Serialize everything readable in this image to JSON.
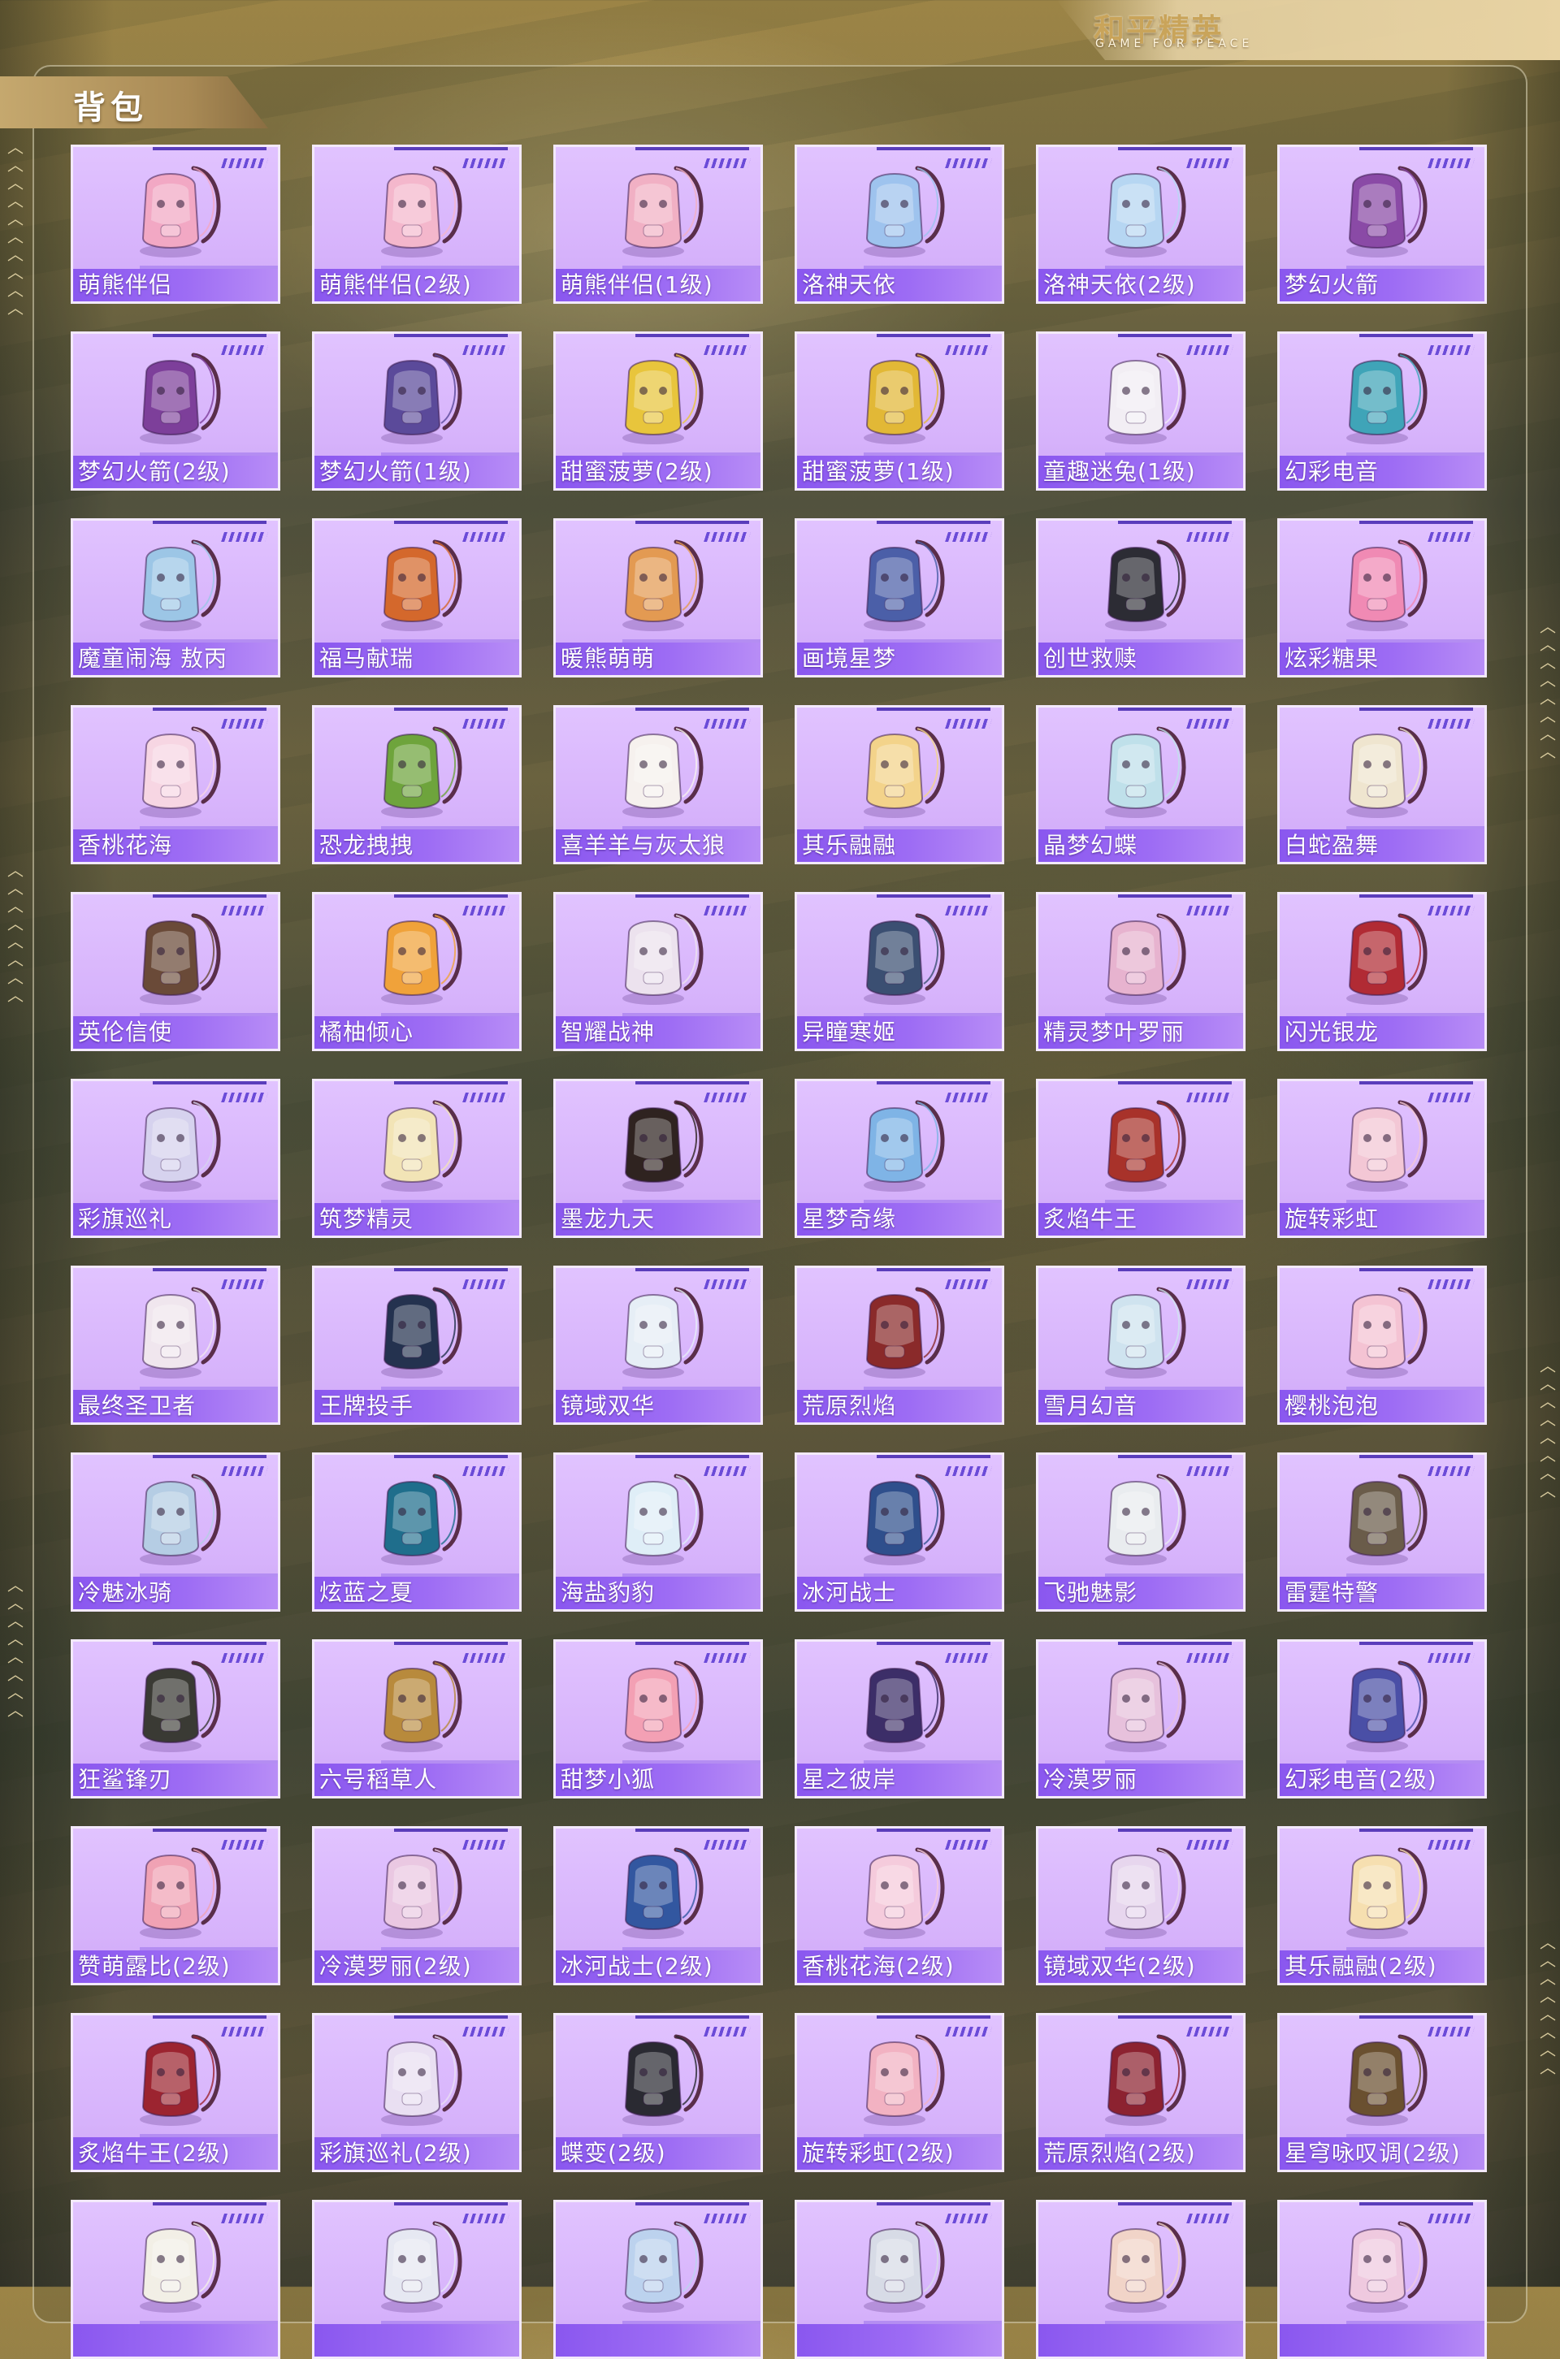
{
  "brand": {
    "title": "和平精英",
    "subtitle": "GAME FOR PEACE"
  },
  "section": {
    "title": "背包"
  },
  "items": [
    {
      "name": "萌熊伴侣",
      "icon": "bear-backpack-icon",
      "color": "#f2a8c4"
    },
    {
      "name": "萌熊伴侣(2级)",
      "icon": "bear-backpack-icon",
      "color": "#f4b7cc"
    },
    {
      "name": "萌熊伴侣(1级)",
      "icon": "bear-backpack-icon",
      "color": "#f1b0c4"
    },
    {
      "name": "洛神天依",
      "icon": "winged-backpack-icon",
      "color": "#9ec3ee"
    },
    {
      "name": "洛神天依(2级)",
      "icon": "winged-backpack-icon",
      "color": "#b6d6f2"
    },
    {
      "name": "梦幻火箭",
      "icon": "rocket-backpack-icon",
      "color": "#8a4aa6"
    },
    {
      "name": "梦幻火箭(2级)",
      "icon": "rocket-backpack-icon",
      "color": "#7d3f9a"
    },
    {
      "name": "梦幻火箭(1级)",
      "icon": "rocket-backpack-icon",
      "color": "#5b4a9a"
    },
    {
      "name": "甜蜜菠萝(2级)",
      "icon": "pineapple-backpack-icon",
      "color": "#e8c53c"
    },
    {
      "name": "甜蜜菠萝(1级)",
      "icon": "pineapple-backpack-icon",
      "color": "#e2b836"
    },
    {
      "name": "童趣迷兔(1级)",
      "icon": "rabbit-backpack-icon",
      "color": "#f2eef4"
    },
    {
      "name": "幻彩电音",
      "icon": "speaker-backpack-icon",
      "color": "#3fa4b8"
    },
    {
      "name": "魔童闹海 敖丙",
      "icon": "swirl-backpack-icon",
      "color": "#9cc6e6"
    },
    {
      "name": "福马献瑞",
      "icon": "horse-backpack-icon",
      "color": "#d4682c"
    },
    {
      "name": "暖熊萌萌",
      "icon": "bear-backpack-icon",
      "color": "#e39a52"
    },
    {
      "name": "画境星梦",
      "icon": "frame-backpack-icon",
      "color": "#4b5fa8"
    },
    {
      "name": "创世救赎",
      "icon": "armor-backpack-icon",
      "color": "#2c2c34"
    },
    {
      "name": "炫彩糖果",
      "icon": "candy-backpack-icon",
      "color": "#f08ab4"
    },
    {
      "name": "香桃花海",
      "icon": "flower-backpack-icon",
      "color": "#f7d6e3"
    },
    {
      "name": "恐龙拽拽",
      "icon": "dino-backpack-icon",
      "color": "#6ea43c"
    },
    {
      "name": "喜羊羊与灰太狼",
      "icon": "sheep-backpack-icon",
      "color": "#f6f1ee"
    },
    {
      "name": "其乐融融",
      "icon": "bunny-backpack-icon",
      "color": "#f3d38a"
    },
    {
      "name": "晶梦幻蝶",
      "icon": "butterfly-backpack-icon",
      "color": "#bfe0ea"
    },
    {
      "name": "白蛇盈舞",
      "icon": "dress-backpack-icon",
      "color": "#efe5cf"
    },
    {
      "name": "英伦信使",
      "icon": "clock-backpack-icon",
      "color": "#6a4a38"
    },
    {
      "name": "橘柚倾心",
      "icon": "orange-backpack-icon",
      "color": "#f0a23a"
    },
    {
      "name": "智耀战神",
      "icon": "warrior-backpack-icon",
      "color": "#ece2ee"
    },
    {
      "name": "异瞳寒姬",
      "icon": "cat-backpack-icon",
      "color": "#3b4f72"
    },
    {
      "name": "精灵梦叶罗丽",
      "icon": "heart-backpack-icon",
      "color": "#e7b3cf"
    },
    {
      "name": "闪光银龙",
      "icon": "dragon-backpack-icon",
      "color": "#b12b34"
    },
    {
      "name": "彩旗巡礼",
      "icon": "star-backpack-icon",
      "color": "#d6d2ee"
    },
    {
      "name": "筑梦精灵",
      "icon": "fairy-backpack-icon",
      "color": "#f2e4b6"
    },
    {
      "name": "墨龙九天",
      "icon": "dragon-backpack-icon",
      "color": "#2f2320"
    },
    {
      "name": "星梦奇缘",
      "icon": "swan-backpack-icon",
      "color": "#7fb4e6"
    },
    {
      "name": "炙焰牛王",
      "icon": "bull-backpack-icon",
      "color": "#a8322a"
    },
    {
      "name": "旋转彩虹",
      "icon": "carousel-backpack-icon",
      "color": "#f3c7d5"
    },
    {
      "name": "最终圣卫者",
      "icon": "mech-backpack-icon",
      "color": "#f0e6ee"
    },
    {
      "name": "王牌投手",
      "icon": "sport-backpack-icon",
      "color": "#24324f"
    },
    {
      "name": "镜域双华",
      "icon": "mirror-backpack-icon",
      "color": "#e6eef6"
    },
    {
      "name": "荒原烈焰",
      "icon": "flame-backpack-icon",
      "color": "#8a2a2a"
    },
    {
      "name": "雪月幻音",
      "icon": "moon-backpack-icon",
      "color": "#cfe3ef"
    },
    {
      "name": "樱桃泡泡",
      "icon": "bow-backpack-icon",
      "color": "#f4c3d3"
    },
    {
      "name": "冷魅冰骑",
      "icon": "ice-backpack-icon",
      "color": "#b5cde4"
    },
    {
      "name": "炫蓝之夏",
      "icon": "tactical-backpack-icon",
      "color": "#1f6e8c"
    },
    {
      "name": "海盐豹豹",
      "icon": "seal-backpack-icon",
      "color": "#dfeef7"
    },
    {
      "name": "冰河战士",
      "icon": "tactical-backpack-icon",
      "color": "#2f4f8c"
    },
    {
      "name": "飞驰魅影",
      "icon": "racer-backpack-icon",
      "color": "#e9ecef"
    },
    {
      "name": "雷霆特警",
      "icon": "tactical-backpack-icon",
      "color": "#6a5c4a"
    },
    {
      "name": "狂鲨锋刃",
      "icon": "shark-backpack-icon",
      "color": "#3a3a34"
    },
    {
      "name": "六号稻草人",
      "icon": "scarecrow-backpack-icon",
      "color": "#b88a3c"
    },
    {
      "name": "甜梦小狐",
      "icon": "fox-backpack-icon",
      "color": "#f3a0b4"
    },
    {
      "name": "星之彼岸",
      "icon": "planet-backpack-icon",
      "color": "#3c2e68"
    },
    {
      "name": "冷漠罗丽",
      "icon": "heart-backpack-icon",
      "color": "#e7c1dc"
    },
    {
      "name": "幻彩电音(2级)",
      "icon": "speaker-backpack-icon",
      "color": "#4a4fa6"
    },
    {
      "name": "赞萌露比(2级)",
      "icon": "beaver-backpack-icon",
      "color": "#f0a2b4"
    },
    {
      "name": "冷漠罗丽(2级)",
      "icon": "heart-backpack-icon",
      "color": "#eac8e2"
    },
    {
      "name": "冰河战士(2级)",
      "icon": "tactical-backpack-icon",
      "color": "#3257a0"
    },
    {
      "name": "香桃花海(2级)",
      "icon": "flower-backpack-icon",
      "color": "#f5cbdc"
    },
    {
      "name": "镜域双华(2级)",
      "icon": "mirror-backpack-icon",
      "color": "#e7d6ee"
    },
    {
      "name": "其乐融融(2级)",
      "icon": "bunny-backpack-icon",
      "color": "#f6dfb0"
    },
    {
      "name": "炙焰牛王(2级)",
      "icon": "bull-backpack-icon",
      "color": "#9c2430"
    },
    {
      "name": "彩旗巡礼(2级)",
      "icon": "star-backpack-icon",
      "color": "#e9dff2"
    },
    {
      "name": "蝶变(2级)",
      "icon": "butterfly-backpack-icon",
      "color": "#2a2a32"
    },
    {
      "name": "旋转彩虹(2级)",
      "icon": "carousel-backpack-icon",
      "color": "#f2b2c2"
    },
    {
      "name": "荒原烈焰(2级)",
      "icon": "flame-backpack-icon",
      "color": "#8c2230"
    },
    {
      "name": "星穹咏叹调(2级)",
      "icon": "frame-backpack-icon",
      "color": "#6a5030"
    },
    {
      "name": "",
      "icon": "backpack-icon",
      "color": "#f2efe6"
    },
    {
      "name": "",
      "icon": "backpack-icon",
      "color": "#e6e8f2"
    },
    {
      "name": "",
      "icon": "backpack-icon",
      "color": "#bcd2ee"
    },
    {
      "name": "",
      "icon": "backpack-icon",
      "color": "#d7dbe6"
    },
    {
      "name": "",
      "icon": "backpack-icon",
      "color": "#f1d4c8"
    },
    {
      "name": "",
      "icon": "backpack-icon",
      "color": "#efc9df"
    }
  ]
}
